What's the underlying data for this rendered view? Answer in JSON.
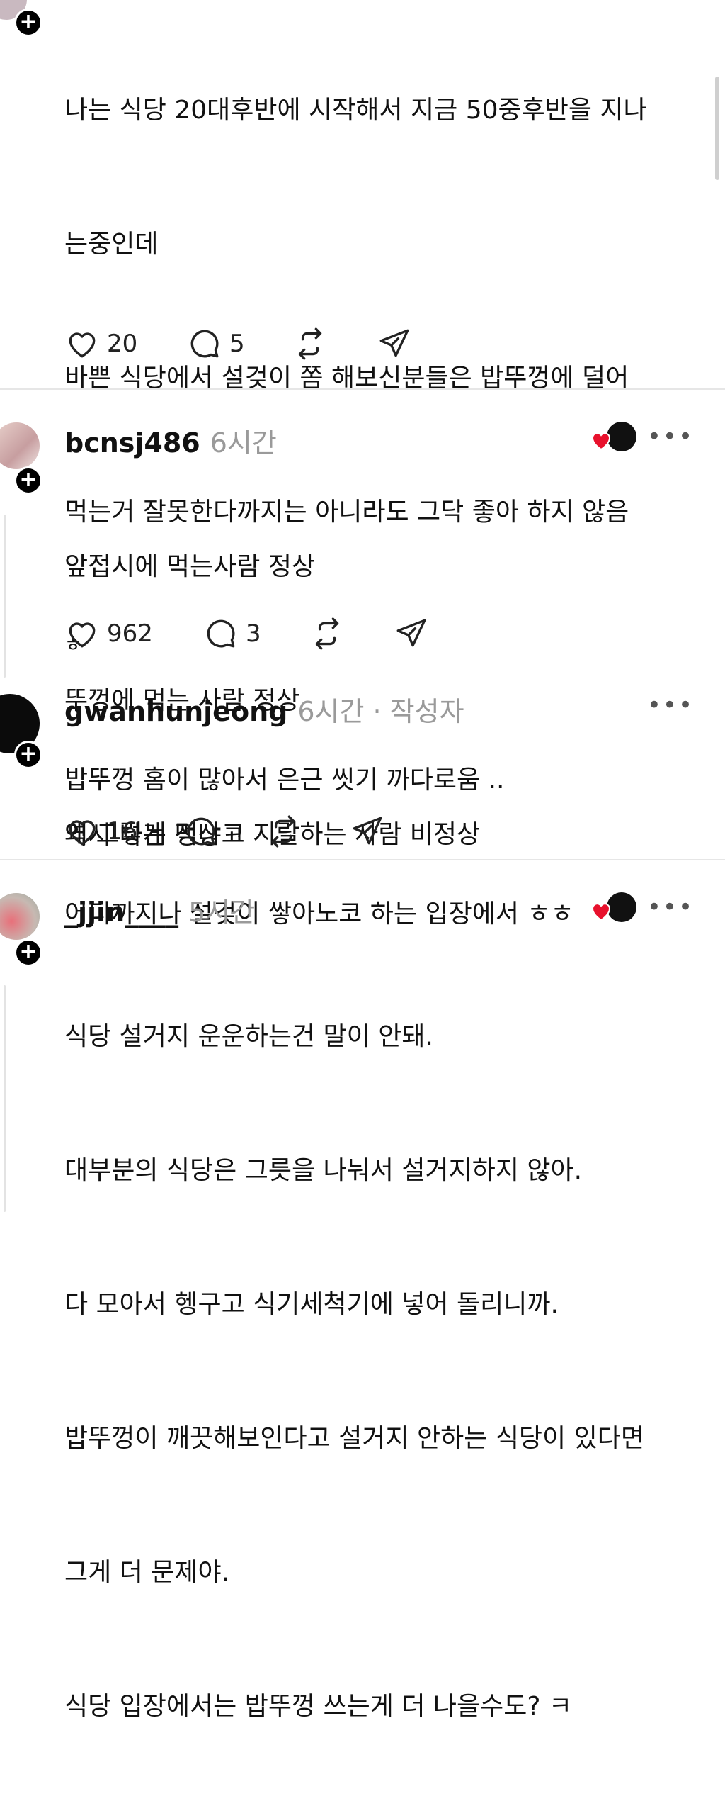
{
  "posts": [
    {
      "lines": [
        "나는 식당 20대후반에 시작해서 지금 50중후반을 지나",
        "는중인데",
        "바쁜 식당에서 설겆이 쫌 해보신분들은 밥뚜껑에 덜어",
        "먹는거  잘못한다까지는 아니라도 그닥 좋아 하지 않음",
        "ㅎ",
        "밥뚜껑 홈이 많아서 은근 씻기 까다로움 ..",
        "어디까지나 설겆이 쌓아노코 하는 입장에서  ㅎㅎ"
      ],
      "likes": "20",
      "replies": "5"
    },
    {
      "username": "bcnsj486",
      "time": "6시간",
      "lines": [
        "앞접시에 먹는사람 정상",
        "뚜껑에 먹는 사람 정상",
        "왜 그렇게 먹냐고 지랄하는 사람 비정상"
      ],
      "likes": "962",
      "replies": "3"
    },
    {
      "username": "gwanhunjeong",
      "time": "6시간 · 작성자",
      "lines": [
        "역시 나는 정상ㅋ"
      ],
      "likes": "16",
      "replies": ""
    },
    {
      "username": "_jjin____",
      "time": "5시간",
      "lines": [
        "식당 설거지 운운하는건 말이 안돼.",
        "대부분의 식당은 그릇을 나눠서 설거지하지 않아.",
        "다 모아서 헹구고 식기세척기에 넣어 돌리니까.",
        "밥뚜껑이 깨끗해보인다고 설거지 안하는 식당이 있다면",
        "그게 더 문제야.",
        "식당 입장에서는 밥뚜껑 쓰는게 더 나을수도? ㅋ"
      ]
    }
  ],
  "ui": {
    "follow_glyph": "+",
    "more_glyph": "•••",
    "heart_color": "#e8112d"
  }
}
